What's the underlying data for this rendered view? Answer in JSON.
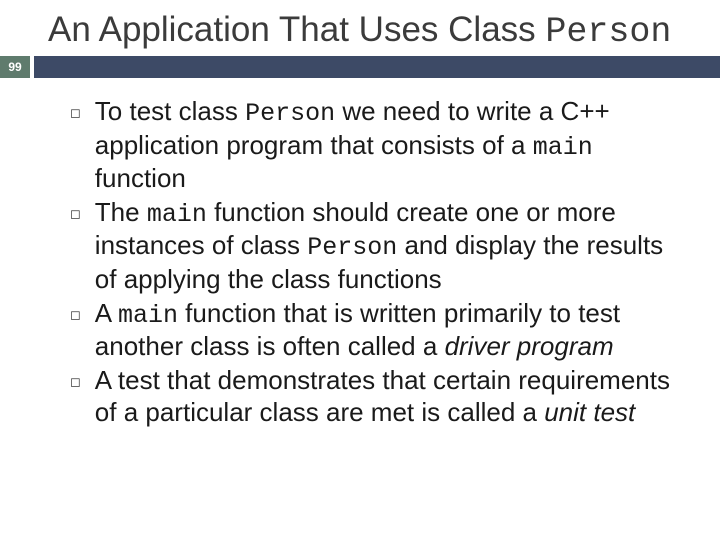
{
  "title_prefix": "An Application That Uses Class",
  "title_mono": "Person",
  "page_number": "99",
  "bullets": [
    {
      "segments": [
        {
          "t": "To test class ",
          "c": ""
        },
        {
          "t": "Person",
          "c": "mono"
        },
        {
          "t": " we need to write a C++ application program that consists of a ",
          "c": ""
        },
        {
          "t": "main",
          "c": "mono"
        },
        {
          "t": " function",
          "c": ""
        }
      ]
    },
    {
      "segments": [
        {
          "t": "The ",
          "c": ""
        },
        {
          "t": "main",
          "c": "mono"
        },
        {
          "t": " function should create one or more instances of class ",
          "c": ""
        },
        {
          "t": "Person",
          "c": "mono"
        },
        {
          "t": " and display the results of applying the class functions",
          "c": ""
        }
      ]
    },
    {
      "segments": [
        {
          "t": "A ",
          "c": ""
        },
        {
          "t": "main",
          "c": "mono"
        },
        {
          "t": " function that is written primarily to test another class is often called a ",
          "c": ""
        },
        {
          "t": "driver program",
          "c": "italic"
        }
      ]
    },
    {
      "segments": [
        {
          "t": "A test that demonstrates that certain requirements of a particular class are met is called a ",
          "c": ""
        },
        {
          "t": "unit test",
          "c": "italic"
        }
      ]
    }
  ]
}
